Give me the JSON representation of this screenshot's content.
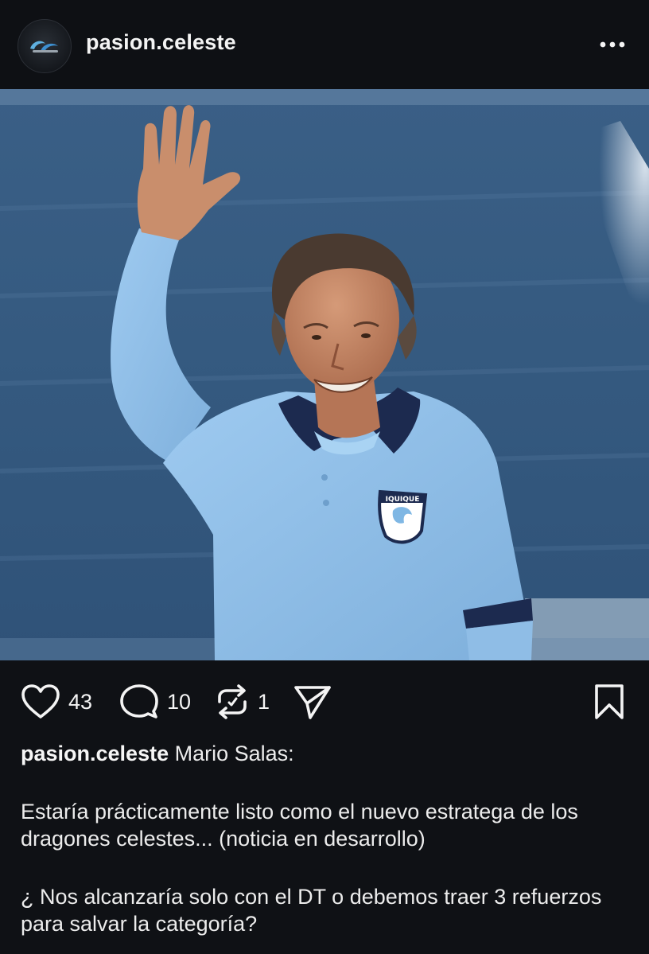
{
  "header": {
    "username": "pasion.celeste",
    "avatar_icon": "pc-logo-icon",
    "more_icon": "more-horizontal-icon"
  },
  "post": {
    "image_alt": "Man in light blue Deportes Iquique polo shirt waving in a stadium",
    "shirt_badge": "IQUIQUE"
  },
  "actions": {
    "like_icon": "heart-icon",
    "like_count": "43",
    "comment_icon": "comment-icon",
    "comment_count": "10",
    "repost_icon": "repost-icon",
    "repost_count": "1",
    "share_icon": "send-icon",
    "save_icon": "bookmark-icon"
  },
  "caption": {
    "username": "pasion.celeste",
    "title": "Mario Salas:",
    "paragraph1": "Estaría prácticamente listo como el nuevo estratega de los dragones celestes... (noticia en desarrollo)",
    "paragraph2": "¿ Nos alcanzaría solo con el DT o debemos traer 3 refuerzos para salvar la categoría?"
  },
  "colors": {
    "background": "#0f1115",
    "text": "#f4f4f4",
    "shirt": "#8fbde6",
    "collar": "#1c2a4f"
  }
}
